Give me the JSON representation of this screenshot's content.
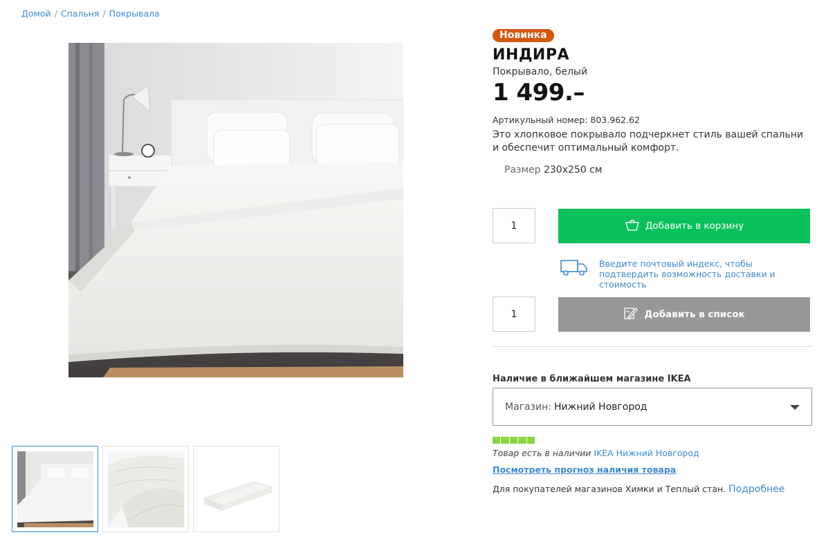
{
  "breadcrumb": {
    "items": [
      "Домой",
      "Спальня",
      "Покрывала"
    ],
    "separator": "/"
  },
  "product": {
    "badge": "Новинка",
    "name": "ИНДИРА",
    "subtitle": "Покрывало, белый",
    "price": "1 499.–",
    "article_label": "Артикульный номер:",
    "article_number": "803.962.62",
    "description": "Это хлопковое покрывало подчеркнет стиль вашей спальни и обеспечит оптимальный комфорт.",
    "size_label": "Размер",
    "size_value": "230x250 см"
  },
  "cart": {
    "quantity": "1",
    "button_label": "Добавить в корзину",
    "button_icon": "basket-icon"
  },
  "delivery": {
    "text": "Введите почтовый индекс, чтобы подтвердить возможность доставки и стоимость",
    "icon": "truck-icon"
  },
  "wishlist": {
    "quantity": "1",
    "button_label": "Добавить в список",
    "button_icon": "edit-list-icon"
  },
  "availability": {
    "title": "Наличие в ближайшем магазине IKEA",
    "store_label": "Магазин:",
    "store_value": "Нижний Новгород",
    "stock_level": 1.0,
    "stock_text": "Товар есть в наличии",
    "store_link": "IKEA Нижний Новгород",
    "forecast_link": "Посмотреть прогноз наличия товара",
    "note_text": "Для покупателей магазинов Химки и Теплый стан.",
    "note_link": "Подробнее"
  },
  "colors": {
    "badge": "#d4570e",
    "cart_button": "#08c15b",
    "list_button": "#989898",
    "link": "#3c8ad0",
    "stock": "#8ad342"
  }
}
